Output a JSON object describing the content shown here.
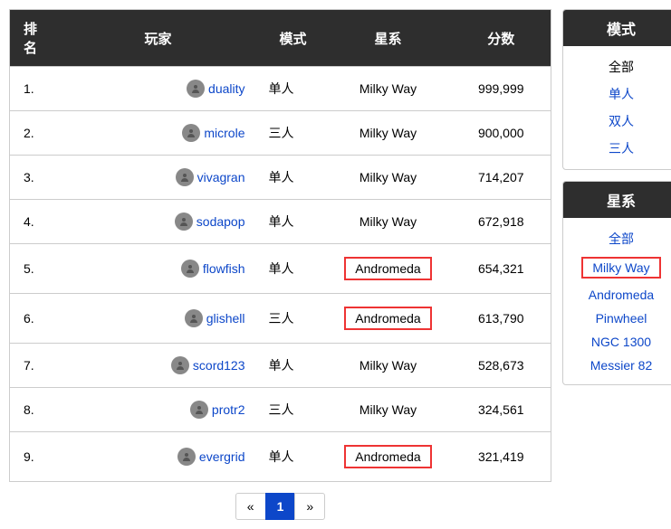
{
  "headers": {
    "rank": "排名",
    "player": "玩家",
    "mode": "模式",
    "galaxy": "星系",
    "score": "分数"
  },
  "rows": [
    {
      "rank": "1.",
      "player": "duality",
      "mode": "单人",
      "galaxy": "Milky Way",
      "score": "999,999",
      "hl": false
    },
    {
      "rank": "2.",
      "player": "microle",
      "mode": "三人",
      "galaxy": "Milky Way",
      "score": "900,000",
      "hl": false
    },
    {
      "rank": "3.",
      "player": "vivagran",
      "mode": "单人",
      "galaxy": "Milky Way",
      "score": "714,207",
      "hl": false
    },
    {
      "rank": "4.",
      "player": "sodapop",
      "mode": "单人",
      "galaxy": "Milky Way",
      "score": "672,918",
      "hl": false
    },
    {
      "rank": "5.",
      "player": "flowfish",
      "mode": "单人",
      "galaxy": "Andromeda",
      "score": "654,321",
      "hl": true
    },
    {
      "rank": "6.",
      "player": "glishell",
      "mode": "三人",
      "galaxy": "Andromeda",
      "score": "613,790",
      "hl": true
    },
    {
      "rank": "7.",
      "player": "scord123",
      "mode": "单人",
      "galaxy": "Milky Way",
      "score": "528,673",
      "hl": false
    },
    {
      "rank": "8.",
      "player": "protr2",
      "mode": "三人",
      "galaxy": "Milky Way",
      "score": "324,561",
      "hl": false
    },
    {
      "rank": "9.",
      "player": "evergrid",
      "mode": "单人",
      "galaxy": "Andromeda",
      "score": "321,419",
      "hl": true
    }
  ],
  "pager": {
    "prev": "«",
    "page": "1",
    "next": "»"
  },
  "mode_panel": {
    "title": "模式",
    "items": [
      {
        "label": "全部",
        "active": true,
        "sel": false
      },
      {
        "label": "单人",
        "active": false,
        "sel": false
      },
      {
        "label": "双人",
        "active": false,
        "sel": false
      },
      {
        "label": "三人",
        "active": false,
        "sel": false
      }
    ]
  },
  "galaxy_panel": {
    "title": "星系",
    "items": [
      {
        "label": "全部",
        "active": false,
        "sel": false
      },
      {
        "label": "Milky Way",
        "active": false,
        "sel": true
      },
      {
        "label": "Andromeda",
        "active": false,
        "sel": false
      },
      {
        "label": "Pinwheel",
        "active": false,
        "sel": false
      },
      {
        "label": "NGC 1300",
        "active": false,
        "sel": false
      },
      {
        "label": "Messier 82",
        "active": false,
        "sel": false
      }
    ]
  },
  "avatar_glyph": "☺"
}
